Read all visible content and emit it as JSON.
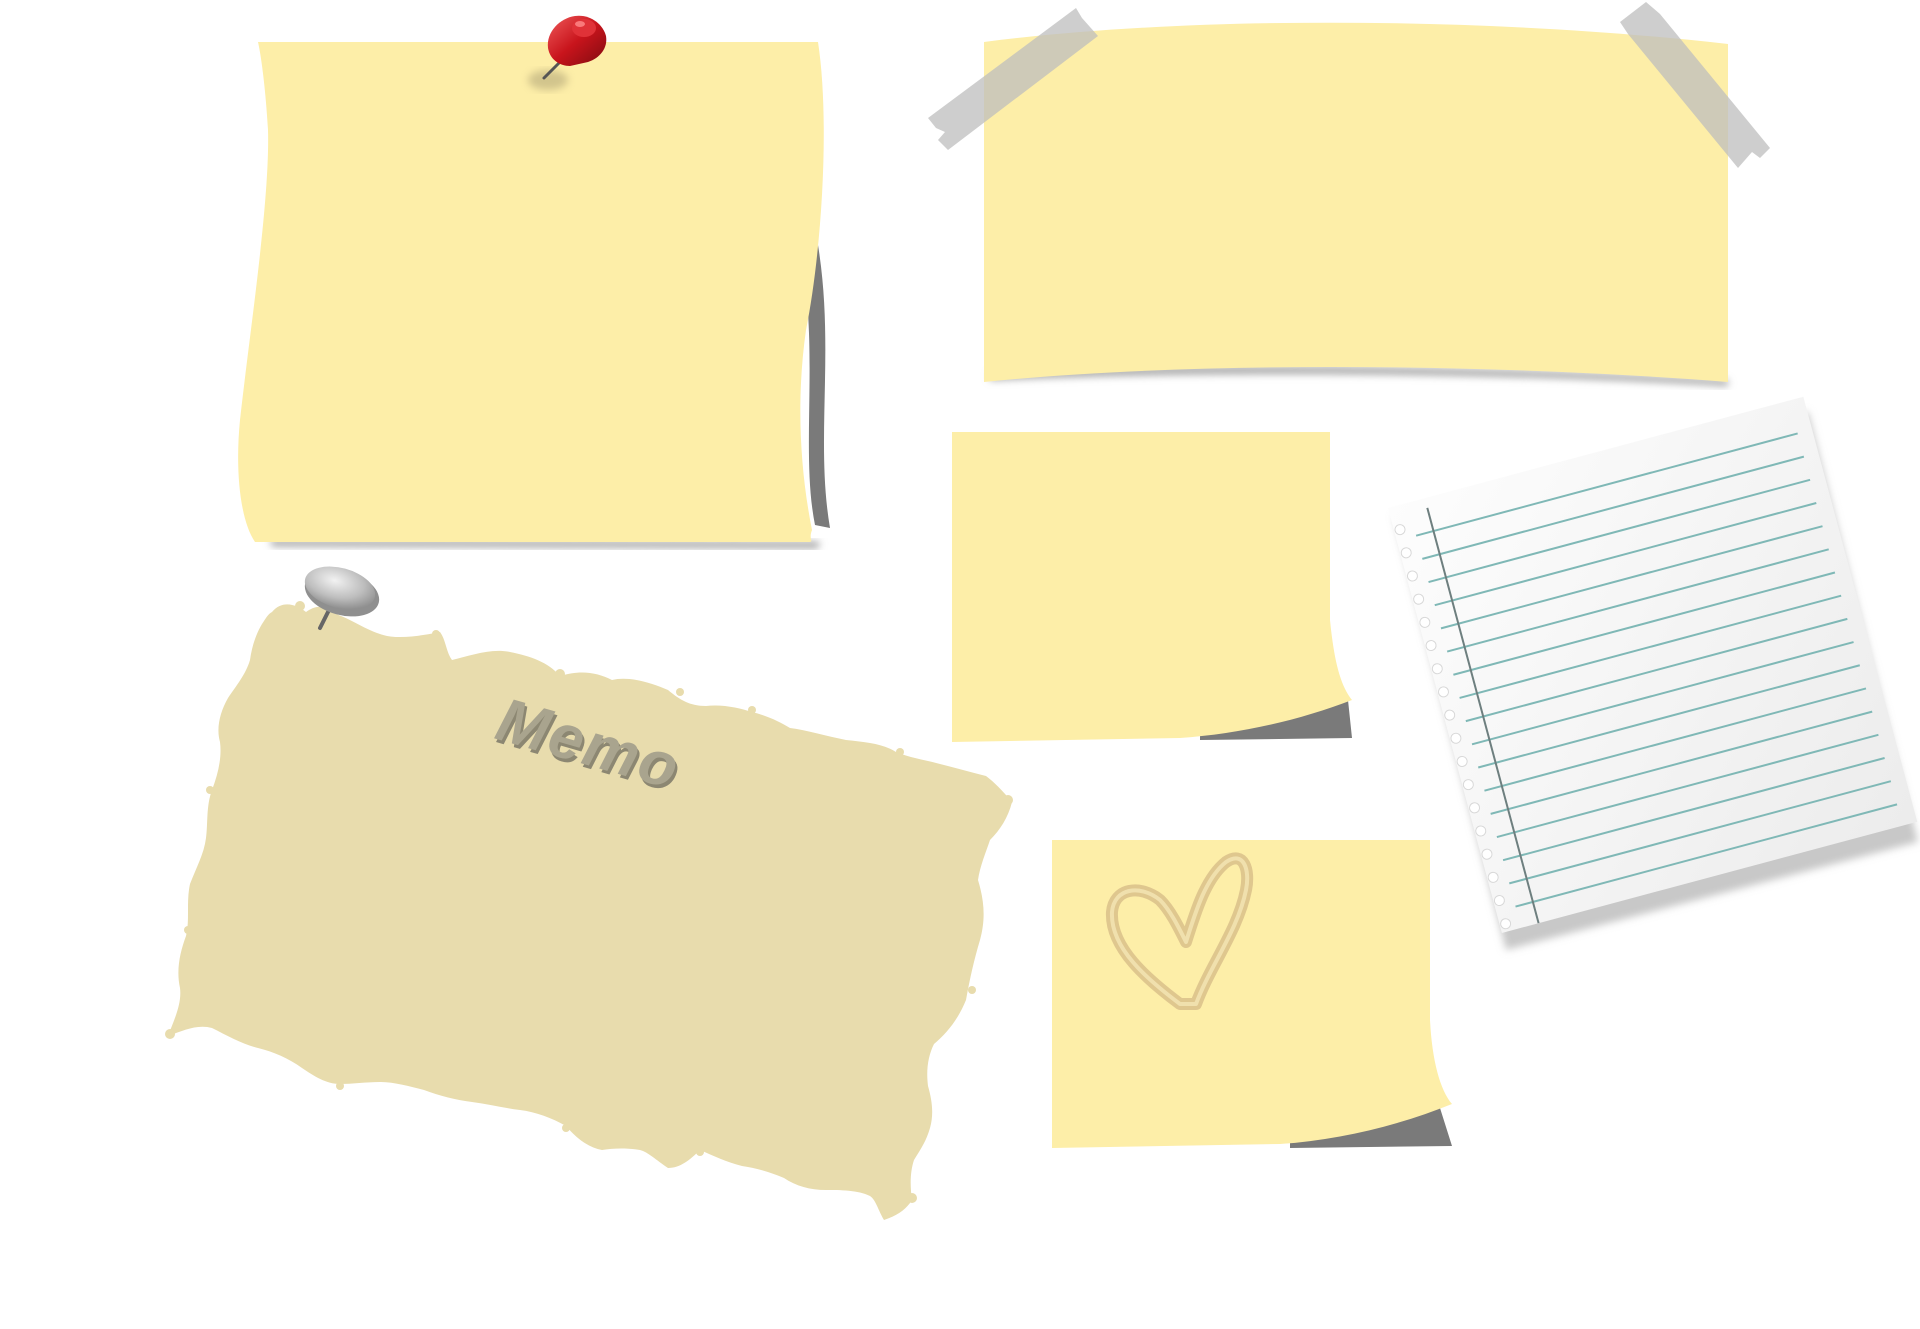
{
  "colors": {
    "background": "#ffffff",
    "sticky_yellow": "#fdeea8",
    "sticky_shadow": "#7a7a7a",
    "torn_paper": "#e8dcad",
    "tape": "#bdbdbd",
    "pin_red": "#c8141c",
    "pin_gray": "#bdbdbd",
    "notebook_paper": "#f1f1f1",
    "notebook_rule": "#7fb8b6",
    "notebook_margin": "#6e7f7f",
    "heart": "#d9c08a"
  },
  "icons": {
    "red_pushpin": "red-pushpin-icon",
    "gray_thumbtack": "thumbtack-icon",
    "heart": "heart-icon"
  },
  "notes": {
    "torn_memo": {
      "label": "Memo"
    }
  }
}
